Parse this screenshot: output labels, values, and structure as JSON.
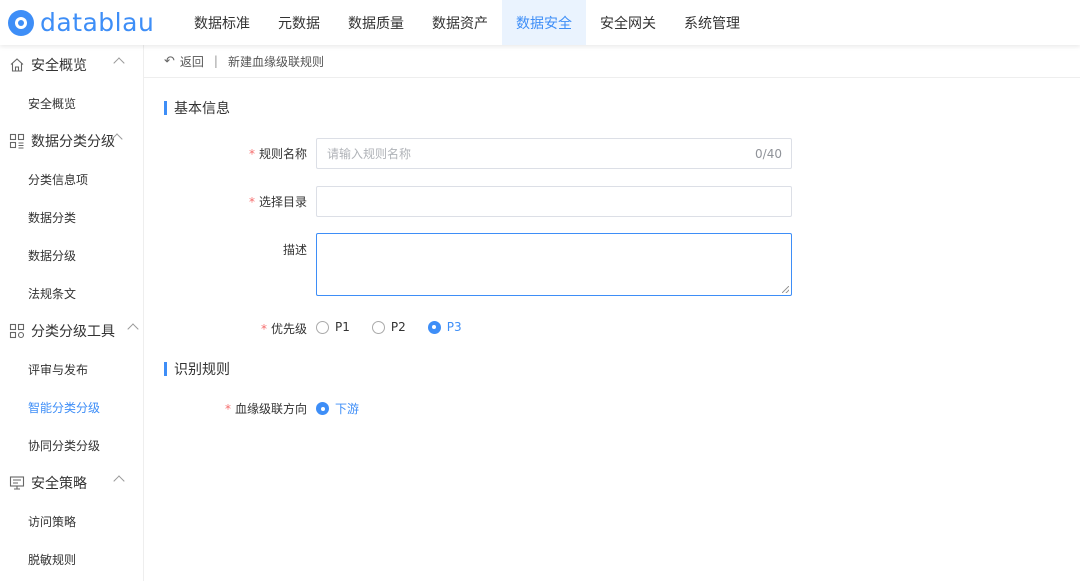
{
  "app": {
    "logo_text": "datablau"
  },
  "nav": {
    "items": [
      {
        "label": "数据标准"
      },
      {
        "label": "元数据"
      },
      {
        "label": "数据质量"
      },
      {
        "label": "数据资产"
      },
      {
        "label": "数据安全",
        "active": true
      },
      {
        "label": "安全网关"
      },
      {
        "label": "系统管理"
      }
    ]
  },
  "sidebar": {
    "groups": [
      {
        "label": "安全概览",
        "icon": "home-icon",
        "items": [
          "安全概览"
        ]
      },
      {
        "label": "数据分类分级",
        "icon": "grid-icon",
        "items": [
          "分类信息项",
          "数据分类",
          "数据分级",
          "法规条文"
        ]
      },
      {
        "label": "分类分级工具",
        "icon": "tool-icon",
        "items": [
          "评审与发布",
          "智能分类分级",
          "协同分类分级"
        ]
      },
      {
        "label": "安全策略",
        "icon": "monitor-icon",
        "items": [
          "访问策略",
          "脱敏规则"
        ]
      }
    ],
    "active_item": "智能分类分级"
  },
  "breadcrumb": {
    "back": "返回",
    "separator": "|",
    "current": "新建血缘级联规则"
  },
  "form": {
    "section_basic": "基本信息",
    "rule_name": {
      "label": "规则名称",
      "placeholder": "请输入规则名称",
      "counter": "0/40"
    },
    "catalog": {
      "label": "选择目录",
      "value": ""
    },
    "description": {
      "label": "描述",
      "value": ""
    },
    "priority": {
      "label": "优先级",
      "options": [
        "P1",
        "P2",
        "P3"
      ],
      "selected": "P3"
    },
    "section_identify": "识别规则",
    "lineage_direction": {
      "label": "血缘级联方向",
      "options": [
        "下游"
      ],
      "selected": "下游"
    }
  },
  "colors": {
    "accent": "#3e8ef7",
    "required": "#f56c6c",
    "active_nav_bg": "#eaf3fe"
  }
}
